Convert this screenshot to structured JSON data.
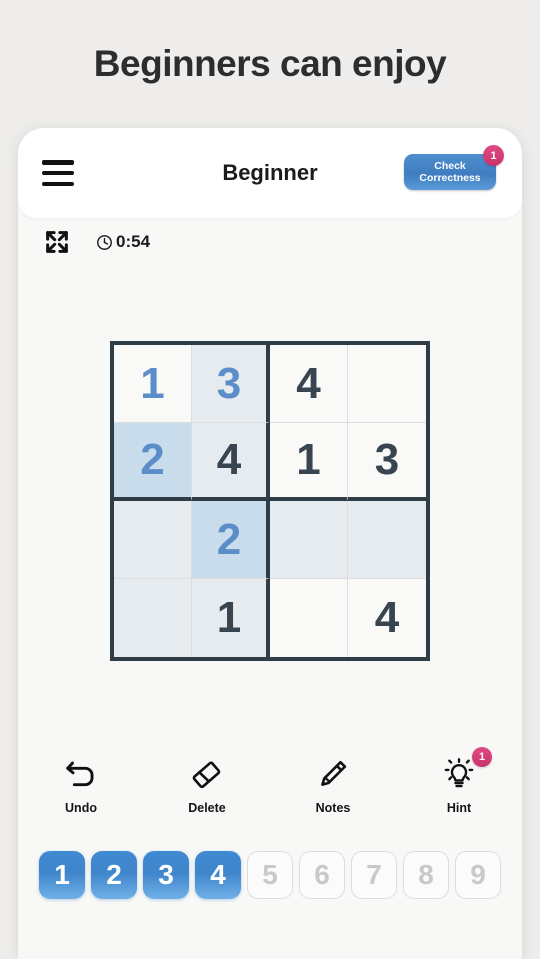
{
  "promo": {
    "heading": "Beginners can enjoy"
  },
  "header": {
    "menu_icon": "hamburger-menu-icon",
    "title": "Beginner",
    "check_button": {
      "label_line1": "Check",
      "label_line2": "Correctness",
      "badge": "1",
      "color": "#3f7dc0",
      "badge_color": "#c9336b"
    }
  },
  "status": {
    "expand_icon": "expand-fullscreen-icon",
    "clock_icon": "clock-icon",
    "timer": "0:54"
  },
  "board": {
    "size": 4,
    "cells": [
      [
        {
          "value": "1",
          "kind": "user",
          "hl": "none"
        },
        {
          "value": "3",
          "kind": "user",
          "hl": "peer"
        },
        {
          "value": "4",
          "kind": "given",
          "hl": "none"
        },
        {
          "value": "",
          "kind": "none",
          "hl": "none"
        }
      ],
      [
        {
          "value": "2",
          "kind": "user",
          "hl": "sel"
        },
        {
          "value": "4",
          "kind": "given",
          "hl": "peer"
        },
        {
          "value": "1",
          "kind": "given",
          "hl": "none"
        },
        {
          "value": "3",
          "kind": "given",
          "hl": "none"
        }
      ],
      [
        {
          "value": "",
          "kind": "none",
          "hl": "peer"
        },
        {
          "value": "2",
          "kind": "user",
          "hl": "sel"
        },
        {
          "value": "",
          "kind": "none",
          "hl": "peer"
        },
        {
          "value": "",
          "kind": "none",
          "hl": "peer"
        }
      ],
      [
        {
          "value": "",
          "kind": "none",
          "hl": "peer"
        },
        {
          "value": "1",
          "kind": "given",
          "hl": "peer"
        },
        {
          "value": "",
          "kind": "none",
          "hl": "none"
        },
        {
          "value": "4",
          "kind": "given",
          "hl": "none"
        }
      ]
    ],
    "colors": {
      "given_text": "#394451",
      "user_text": "#5b8dc8",
      "selected_bg": "#c8dcec",
      "peer_bg": "#e5ebee",
      "grid_line": "#2f3e46"
    }
  },
  "tools": [
    {
      "icon": "undo-arrow-icon",
      "label": "Undo",
      "badge": null
    },
    {
      "icon": "eraser-icon",
      "label": "Delete",
      "badge": null
    },
    {
      "icon": "pencil-icon",
      "label": "Notes",
      "badge": null
    },
    {
      "icon": "lightbulb-icon",
      "label": "Hint",
      "badge": "1"
    }
  ],
  "numpad": [
    {
      "label": "1",
      "enabled": true
    },
    {
      "label": "2",
      "enabled": true
    },
    {
      "label": "3",
      "enabled": true
    },
    {
      "label": "4",
      "enabled": true
    },
    {
      "label": "5",
      "enabled": false
    },
    {
      "label": "6",
      "enabled": false
    },
    {
      "label": "7",
      "enabled": false
    },
    {
      "label": "8",
      "enabled": false
    },
    {
      "label": "9",
      "enabled": false
    }
  ]
}
